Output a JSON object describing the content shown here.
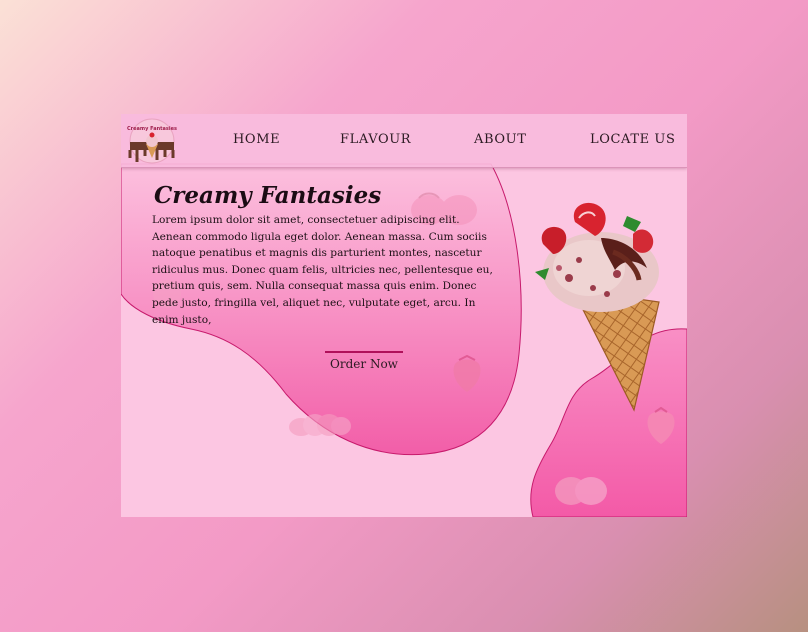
{
  "nav": {
    "logo_text": "Creamy Fantasies",
    "items": [
      "HOME",
      "FLAVOUR",
      "ABOUT",
      "LOCATE US"
    ]
  },
  "hero": {
    "title": "Creamy Fantasies",
    "description": "Lorem ipsum dolor sit amet, consectetuer adipiscing elit. Aenean commodo ligula eget dolor. Aenean massa. Cum sociis natoque penatibus et magnis dis parturient montes, nascetur ridiculus mus. Donec quam felis, ultricies nec, pellentesque eu, pretium quis, sem. Nulla consequat massa quis enim. Donec pede justo, fringilla vel, aliquet nec, vulputate eget, arcu. In enim justo,",
    "button_label": "Order Now"
  },
  "colors": {
    "page_bg_start": "#fbe1d6",
    "page_bg_end": "#b79080",
    "frame_bg": "#fcc6e2",
    "blob": "#f56fb0",
    "accent_line": "#b0105a"
  },
  "icons": [
    "ice-cream-cone-icon",
    "strawberry-icon",
    "logo-icon"
  ]
}
